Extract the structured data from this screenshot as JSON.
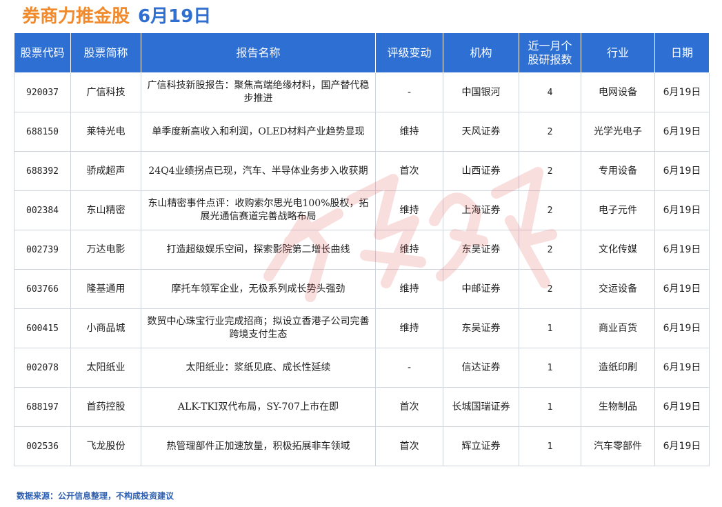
{
  "title": {
    "main": "券商力推金股",
    "date": "6月19日"
  },
  "table": {
    "headers": [
      "股票代码",
      "股票简称",
      "报告名称",
      "评级变动",
      "机构",
      "近一月个\n股研报数",
      "行业",
      "日期"
    ],
    "rows": [
      [
        "920037",
        "广信科技",
        "广信科技新股报告：聚焦高端绝缘材料，国产替代稳步推进",
        "-",
        "中国银河",
        "4",
        "电网设备",
        "6月19日"
      ],
      [
        "688150",
        "莱特光电",
        "单季度新高收入和利润，OLED材料产业趋势显现",
        "维持",
        "天风证券",
        "2",
        "光学光电子",
        "6月19日"
      ],
      [
        "688392",
        "骄成超声",
        "24Q4业绩拐点已现，汽车、半导体业务步入收获期",
        "首次",
        "山西证券",
        "2",
        "专用设备",
        "6月19日"
      ],
      [
        "002384",
        "东山精密",
        "东山精密事件点评：收购索尔思光电100%股权，拓展光通信赛道完善战略布局",
        "维持",
        "上海证券",
        "2",
        "电子元件",
        "6月19日"
      ],
      [
        "002739",
        "万达电影",
        "打造超级娱乐空间，探索影院第二增长曲线",
        "维持",
        "东吴证券",
        "2",
        "文化传媒",
        "6月19日"
      ],
      [
        "603766",
        "隆基通用",
        "摩托车领军企业，无极系列成长势头强劲",
        "维持",
        "中邮证券",
        "2",
        "交运设备",
        "6月19日"
      ],
      [
        "600415",
        "小商品城",
        "数贸中心珠宝行业完成招商；拟设立香港子公司完善跨境支付生态",
        "维持",
        "东吴证券",
        "1",
        "商业百货",
        "6月19日"
      ],
      [
        "002078",
        "太阳纸业",
        "太阳纸业：浆纸见底、成长性延续",
        "-",
        "信达证券",
        "1",
        "造纸印刷",
        "6月19日"
      ],
      [
        "688197",
        "首药控股",
        "ALK-TKI双代布局，SY-707上市在即",
        "首次",
        "长城国瑞证券",
        "1",
        "生物制品",
        "6月19日"
      ],
      [
        "002536",
        "飞龙股份",
        "热管理部件正加速放量，积极拓展非车领域",
        "首次",
        "辉立证券",
        "1",
        "汽车零部件",
        "6月19日"
      ]
    ]
  },
  "footer": "数据来源：公开信息整理，不构成投资建议",
  "colors": {
    "header_bg": "#2e6fd3",
    "title_orange": "#f08a2c",
    "title_blue": "#2f6fd0",
    "watermark": "#e05050"
  }
}
